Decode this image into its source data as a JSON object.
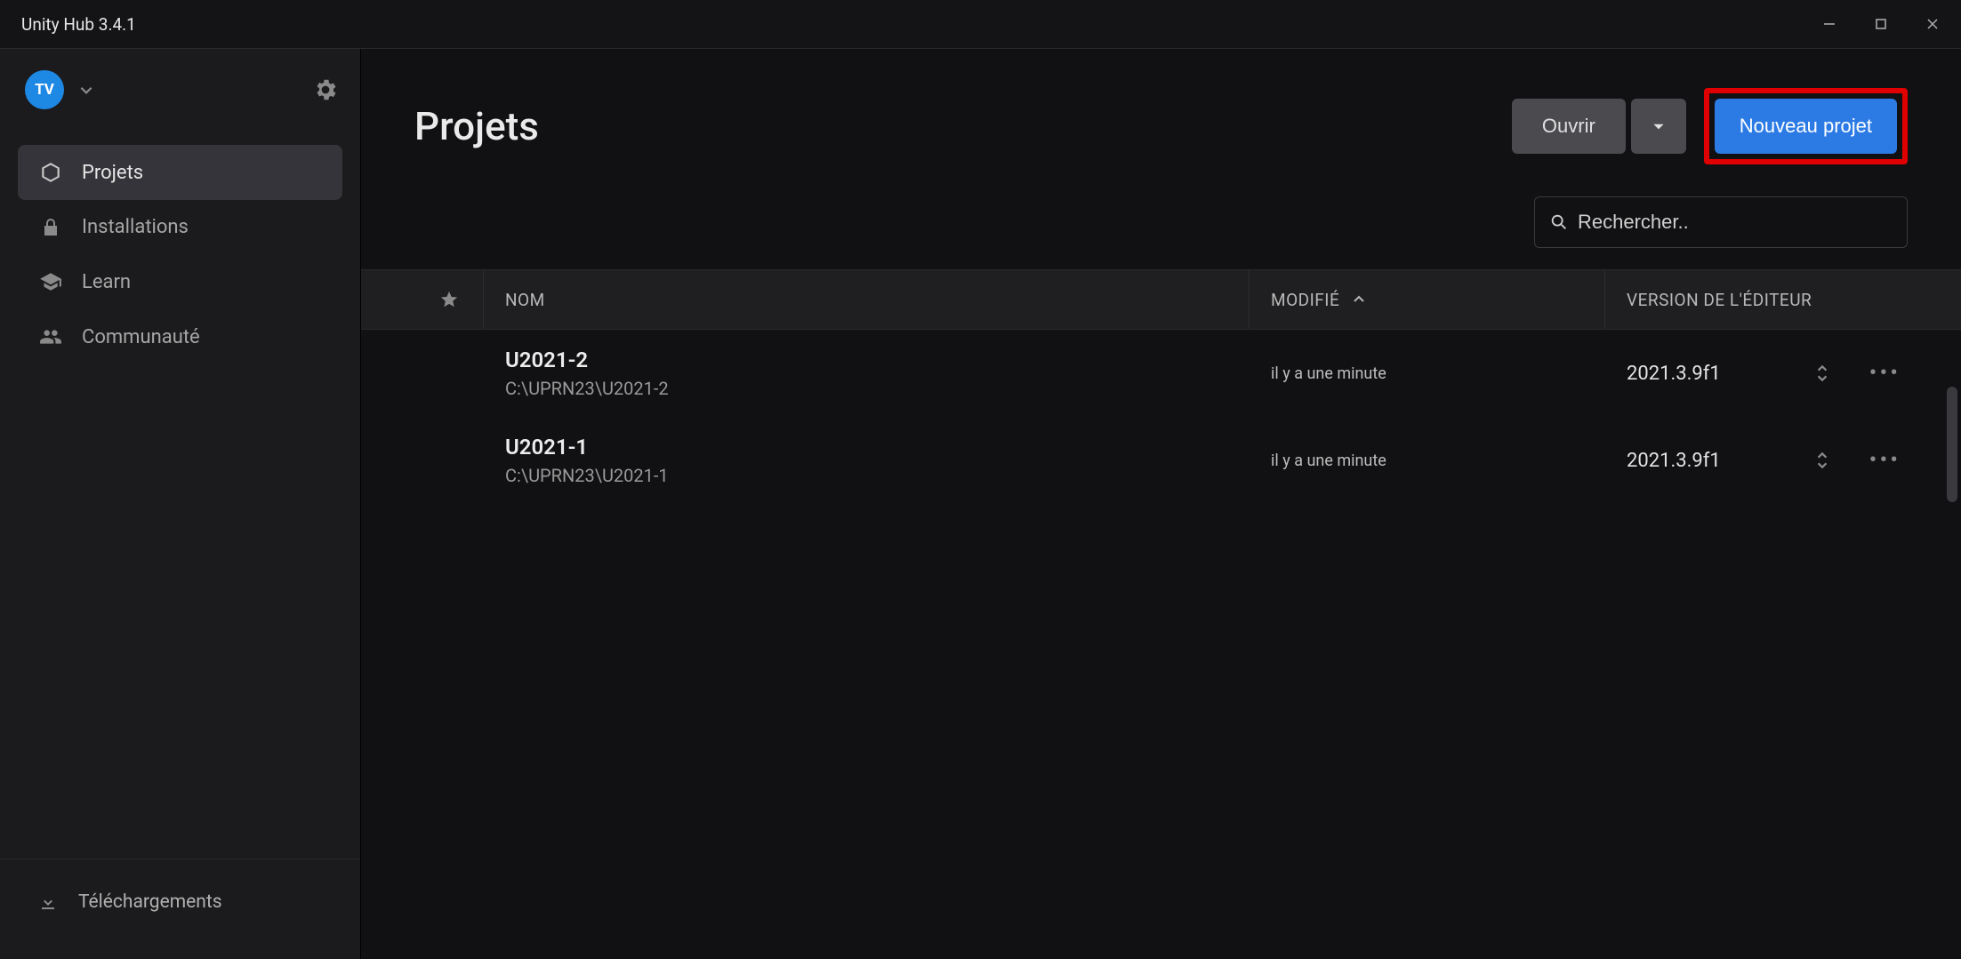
{
  "window": {
    "title": "Unity Hub 3.4.1"
  },
  "user": {
    "initials": "TV"
  },
  "sidebar": {
    "items": [
      {
        "label": "Projets",
        "icon": "cube"
      },
      {
        "label": "Installations",
        "icon": "lock"
      },
      {
        "label": "Learn",
        "icon": "grad-cap"
      },
      {
        "label": "Communauté",
        "icon": "people"
      }
    ],
    "downloads_label": "Téléchargements"
  },
  "header": {
    "title": "Projets",
    "open_label": "Ouvrir",
    "new_label": "Nouveau projet"
  },
  "search": {
    "placeholder": "Rechercher.."
  },
  "table": {
    "columns": {
      "name": "NOM",
      "modified": "MODIFIÉ",
      "version": "VERSION DE L'ÉDITEUR"
    },
    "rows": [
      {
        "name": "U2021-2",
        "path": "C:\\UPRN23\\U2021-2",
        "modified": "il y a une minute",
        "version": "2021.3.9f1"
      },
      {
        "name": "U2021-1",
        "path": "C:\\UPRN23\\U2021-1",
        "modified": "il y a une minute",
        "version": "2021.3.9f1"
      }
    ]
  }
}
